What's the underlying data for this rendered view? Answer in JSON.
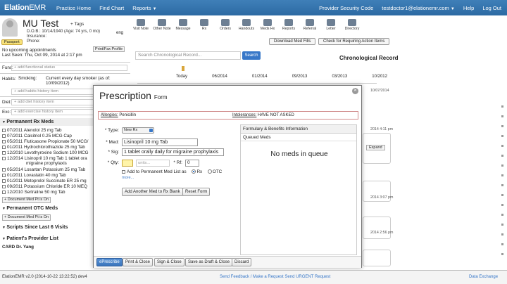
{
  "nav": {
    "logo_bold": "Elation",
    "logo_rest": "EMR",
    "links": [
      "Practice Home",
      "Find Chart",
      "Reports"
    ],
    "right": [
      "Provider Security Code",
      "testdoctor1@elationemr.com",
      "Help",
      "Log Out"
    ]
  },
  "patient": {
    "name": "MU Test",
    "tags": "+ Tags",
    "dob": "D.O.B.: 10/14/1940 (Age: 74 yrs, 0 mo)",
    "insurance": "Insurance:",
    "phone": "Phone:",
    "lang": "eng",
    "passport": "Passport"
  },
  "left": {
    "appointments": "No upcoming appointments",
    "last_seen": "Last Seen: Thu, Oct 09, 2014 at 2:17 pm",
    "print_btn": "Print/Fax Profile",
    "func_label": "Func:",
    "func_placeholder": "+ add functional status",
    "habits_label": "Habits:",
    "smoking_label": "Smoking:",
    "smoking_value": "Current every day smoker (as of: 10/09/2012)",
    "habits_placeholder": "+ add habits history item",
    "diet_label": "Diet:",
    "diet_placeholder": "+ add diet history item",
    "exc_label": "Exc:",
    "exc_placeholder": "+ add exercise history item",
    "rx_section": "Permanent Rx Meds",
    "rx_meds": [
      "07/2011  Atenolol 25 mg Tab",
      "07/2011  Calcitriol 0.25 MCG Cap",
      "05/2011  Fluticasone Propionate 50 MCG/",
      "01/2011  Hydrochlorothiazide 25 mg Tab",
      "12/2010  Levothyroxine Sodium 100 MCG",
      "12/2014  Lisinopril 10 mg Tab 1 tablet ora",
      "migraine prophylaxis",
      "05/2014  Losartan Potassium 25 mg Tab",
      "01/2011  Lovastatin 40 mg Tab",
      "01/2011  Metoprolol Succinate ER 25 mg",
      "09/2011  Potassium Chloride ER 10 MEQ",
      "12/2010  Sertraline 50 mg Tab"
    ],
    "doc_btn": "+ Document Med Pt is On",
    "otc_section": "Permanent OTC Meds",
    "doc_btn2": "+ Document Med Pt is On",
    "scripts_section": "Scripts Since Last 6 Visits",
    "provider_section": "Patient's Provider List",
    "provider_item": "CARD   Dr. Yang"
  },
  "toolbar": {
    "tools": [
      "Visit Note",
      "Other Note",
      "Message",
      "Rx",
      "Orders",
      "Handouts",
      "Meds Hx",
      "Reports",
      "Referral",
      "Letter",
      "Directory"
    ],
    "download": "Download Med Fills",
    "check": "Check for Requiring Action Items",
    "search_placeholder": "Search Chronological Record...",
    "search_btn": "Search",
    "chrono_title": "Chronological Record",
    "timeline": [
      "Today",
      "06/2014",
      "01/2014",
      "09/2013",
      "03/2013",
      "10/2012"
    ]
  },
  "right_cards": {
    "expand": "Expand",
    "ts1": "10/07/2014",
    "ts2": "2014 4:11 pm",
    "ts3": "2014 3:07 pm",
    "ts4": "2014 2:56 pm"
  },
  "modal": {
    "title": "Prescription",
    "subtitle": "Form",
    "allergies_label": "Allergies:",
    "allergies_value": "Penicillin",
    "intolerances_label": "Intolerances:",
    "intolerances_value": "HAVE NOT ASKED",
    "type_label": "* Type:",
    "type_value": "New Rx",
    "med_label": "* Med:",
    "med_value": "Lisinopril 10 mg Tab",
    "sig_label": "* Sig:",
    "sig_value": "1 tablet orally daily for migraine prophylaxis",
    "qty_label": "* Qty:",
    "units_placeholder": "units...",
    "rf_label": "* Rf:",
    "rf_value": "0",
    "add_perm": "Add to Permanent Med List as",
    "rx_opt": "Rx",
    "otc_opt": "OTC",
    "more": "more...",
    "add_another": "Add Another Med to Rx Blank",
    "reset": "Reset Form",
    "formulary": "Formulary & Benefits Information",
    "queued": "Queued Meds",
    "no_meds": "No meds in queue",
    "footer_btns": [
      "ePrescribe",
      "Print & Close",
      "Sign & Close",
      "Save as Draft & Close",
      "Discard"
    ]
  },
  "status": {
    "version": "ElationEMR v2.0 (2014-10-22 13:22:52) dev4",
    "feedback": "Send Feedback / Make a Request   Send URGENT Request",
    "data_exchange": "Data Exchange"
  }
}
